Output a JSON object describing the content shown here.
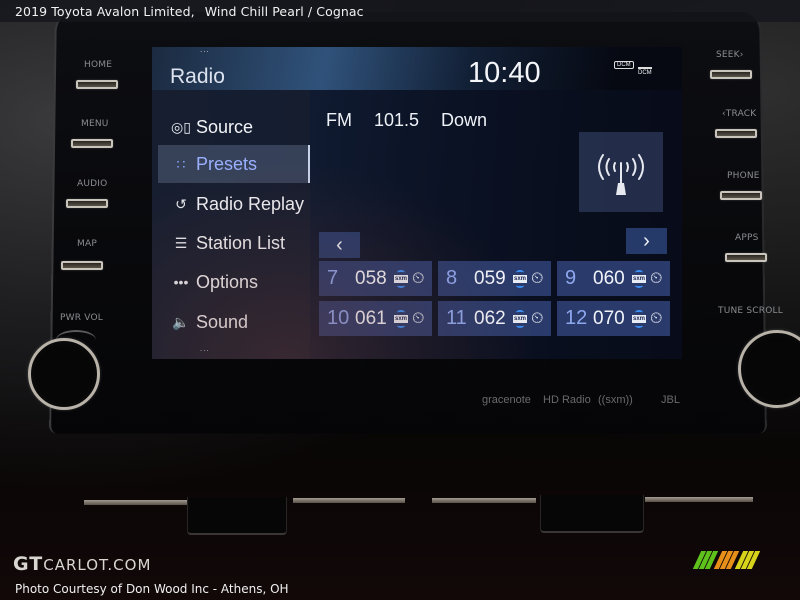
{
  "caption": {
    "vehicle": "2019 Toyota Avalon Limited,",
    "colors": "Wind Chill Pearl / Cognac"
  },
  "hard_buttons": {
    "left": [
      "HOME",
      "MENU",
      "AUDIO",
      "MAP"
    ],
    "right": [
      "SEEK›",
      "‹TRACK",
      "PHONE",
      "APPS"
    ],
    "left_knob": "PWR VOL",
    "right_knob": "TUNE SCROLL"
  },
  "screen": {
    "title": "Radio",
    "clock": "10:40",
    "status_icons": [
      "DCM",
      "DCM"
    ],
    "sidebar": {
      "items": [
        {
          "label": "Source",
          "icon": "source-icon",
          "glyph": "◎▯",
          "active": false
        },
        {
          "label": "Presets",
          "icon": "presets-icon",
          "glyph": "∷",
          "active": true
        },
        {
          "label": "Radio Replay",
          "icon": "radio-replay-icon",
          "glyph": "↺",
          "active": false
        },
        {
          "label": "Station List",
          "icon": "station-list-icon",
          "glyph": "☰",
          "active": false
        },
        {
          "label": "Options",
          "icon": "options-icon",
          "glyph": "•••",
          "active": false
        },
        {
          "label": "Sound",
          "icon": "sound-icon",
          "glyph": "🔈",
          "active": false
        }
      ]
    },
    "now_playing": {
      "band": "FM",
      "frequency": "101.5",
      "station_name": "Down"
    },
    "nav": {
      "prev": "‹",
      "next": "›"
    },
    "presets": [
      {
        "number": "7",
        "channel": "058",
        "source": "sxm"
      },
      {
        "number": "8",
        "channel": "059",
        "source": "sxm"
      },
      {
        "number": "9",
        "channel": "060",
        "source": "sxm"
      },
      {
        "number": "10",
        "channel": "061",
        "source": "sxm"
      },
      {
        "number": "11",
        "channel": "062",
        "source": "sxm"
      },
      {
        "number": "12",
        "channel": "070",
        "source": "sxm"
      }
    ]
  },
  "logos": [
    "gracenote",
    "HD Radio",
    "((sxm))",
    "JBL"
  ],
  "watermark": {
    "site_big": "GT",
    "site_small": "CARLOT.COM",
    "credit": "Photo Courtesy of Don Wood Inc - Athens, OH",
    "stripe_colors": [
      "#5fc21c",
      "#5fc21c",
      "#5fc21c",
      "#e88f1a",
      "#e88f1a",
      "#e88f1a",
      "#d7d21a",
      "#d7d21a",
      "#d7d21a"
    ]
  }
}
